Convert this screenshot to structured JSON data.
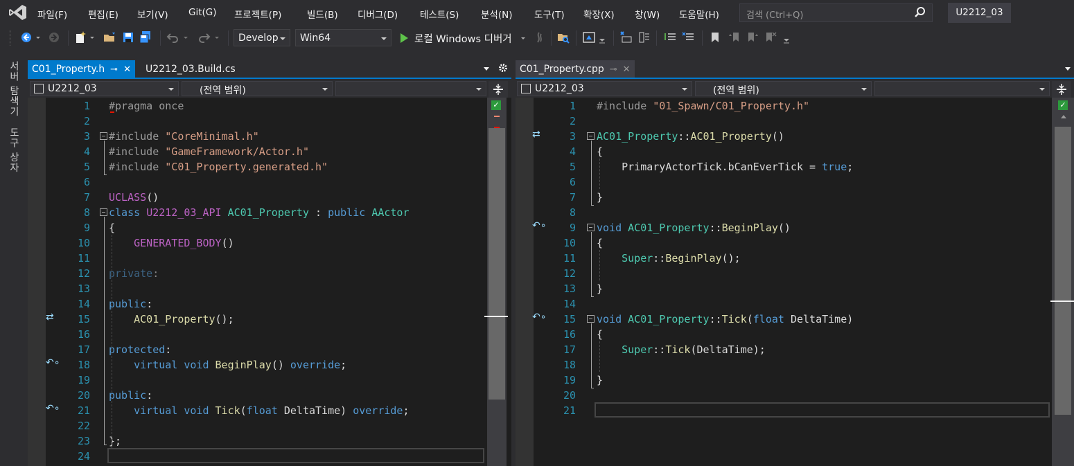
{
  "menu": {
    "items": [
      "파일(F)",
      "편집(E)",
      "보기(V)",
      "Git(G)",
      "프로젝트(P)",
      "빌드(B)",
      "디버그(D)",
      "테스트(S)",
      "분석(N)",
      "도구(T)",
      "확장(X)",
      "창(W)",
      "도움말(H)"
    ],
    "search_placeholder": "검색 (Ctrl+Q)",
    "project_name": "U2212_03"
  },
  "toolbar": {
    "configuration": "Develop",
    "platform": "Win64",
    "run_label": "로컬 Windows 디버거"
  },
  "side_tabs": [
    "서버 탐색기",
    "도구 상자"
  ],
  "left_pane": {
    "tabs": [
      {
        "label": "C01_Property.h",
        "active": true
      },
      {
        "label": "U2212_03.Build.cs",
        "active": false
      }
    ],
    "nav": {
      "project": "U2212_03",
      "scope": "(전역 범위)",
      "member": ""
    }
  },
  "right_pane": {
    "tabs": [
      {
        "label": "C01_Property.cpp",
        "active": false
      }
    ],
    "nav": {
      "project": "U2212_03",
      "scope": "(전역 범위)",
      "member": ""
    }
  },
  "left_code": [
    {
      "n": "1",
      "html": "<span class='pp'>#pragma once</span>"
    },
    {
      "n": "2",
      "html": ""
    },
    {
      "n": "3",
      "html": "<span class='pp'>#include </span><span class='s'>\"CoreMinimal.h\"</span>"
    },
    {
      "n": "4",
      "html": "<span class='pp'>#include </span><span class='s'>\"GameFramework/Actor.h\"</span>"
    },
    {
      "n": "5",
      "html": "<span class='pp'>#include </span><span class='s'>\"C01_Property.generated.h\"</span>"
    },
    {
      "n": "6",
      "html": ""
    },
    {
      "n": "7",
      "html": "<span class='m'>UCLASS</span>()"
    },
    {
      "n": "8",
      "html": "<span class='k'>class</span> <span class='m'>U2212_03_API</span> <span class='t'>AC01_Property</span> : <span class='k'>public</span> <span class='t'>AActor</span>"
    },
    {
      "n": "9",
      "html": "{"
    },
    {
      "n": "10",
      "html": "    <span class='m'>GENERATED_BODY</span>()"
    },
    {
      "n": "11",
      "html": ""
    },
    {
      "n": "12",
      "html": "<span class='k' style='opacity:.55'>private</span><span style='opacity:.55'>:</span>"
    },
    {
      "n": "13",
      "html": ""
    },
    {
      "n": "14",
      "html": "<span class='k'>public</span>:"
    },
    {
      "n": "15",
      "html": "    <span class='f'>AC01_Property</span>();"
    },
    {
      "n": "16",
      "html": ""
    },
    {
      "n": "17",
      "html": "<span class='k'>protected</span>:"
    },
    {
      "n": "18",
      "html": "    <span class='k'>virtual</span> <span class='k'>void</span> <span class='f'>BeginPlay</span>() <span class='k'>override</span>;"
    },
    {
      "n": "19",
      "html": ""
    },
    {
      "n": "20",
      "html": "<span class='k'>public</span>:"
    },
    {
      "n": "21",
      "html": "    <span class='k'>virtual</span> <span class='k'>void</span> <span class='f'>Tick</span>(<span class='k'>float</span> <span class='v'>DeltaTime</span>) <span class='k'>override</span>;"
    },
    {
      "n": "22",
      "html": ""
    },
    {
      "n": "23",
      "html": "};"
    },
    {
      "n": "24",
      "html": ""
    }
  ],
  "right_code": [
    {
      "n": "1",
      "html": "<span class='pp'>#include </span><span class='s'>\"01_Spawn/C01_Property.h\"</span>"
    },
    {
      "n": "2",
      "html": ""
    },
    {
      "n": "3",
      "html": "<span class='t'>AC01_Property</span>::<span class='f'>AC01_Property</span>()"
    },
    {
      "n": "4",
      "html": "{"
    },
    {
      "n": "5",
      "html": "    <span class='v'>PrimaryActorTick</span>.<span class='v'>bCanEverTick</span> = <span class='k'>true</span>;"
    },
    {
      "n": "6",
      "html": ""
    },
    {
      "n": "7",
      "html": "}"
    },
    {
      "n": "8",
      "html": ""
    },
    {
      "n": "9",
      "html": "<span class='k'>void</span> <span class='t'>AC01_Property</span>::<span class='f'>BeginPlay</span>()"
    },
    {
      "n": "10",
      "html": "{"
    },
    {
      "n": "11",
      "html": "    <span class='t'>Super</span>::<span class='f'>BeginPlay</span>();"
    },
    {
      "n": "12",
      "html": ""
    },
    {
      "n": "13",
      "html": "}"
    },
    {
      "n": "14",
      "html": ""
    },
    {
      "n": "15",
      "html": "<span class='k'>void</span> <span class='t'>AC01_Property</span>::<span class='f'>Tick</span>(<span class='k'>float</span> <span class='v'>DeltaTime</span>)"
    },
    {
      "n": "16",
      "html": "{"
    },
    {
      "n": "17",
      "html": "    <span class='t'>Super</span>::<span class='f'>Tick</span>(<span class='v'>DeltaTime</span>);"
    },
    {
      "n": "18",
      "html": ""
    },
    {
      "n": "19",
      "html": "}"
    },
    {
      "n": "20",
      "html": ""
    },
    {
      "n": "21",
      "html": ""
    }
  ],
  "colors": {
    "accent": "#007acc",
    "keyword": "#569cd6",
    "string": "#d69d85",
    "type": "#4ec9b0",
    "macro": "#bd63c5",
    "function": "#dcdcaa",
    "line_number": "#2b91af"
  }
}
